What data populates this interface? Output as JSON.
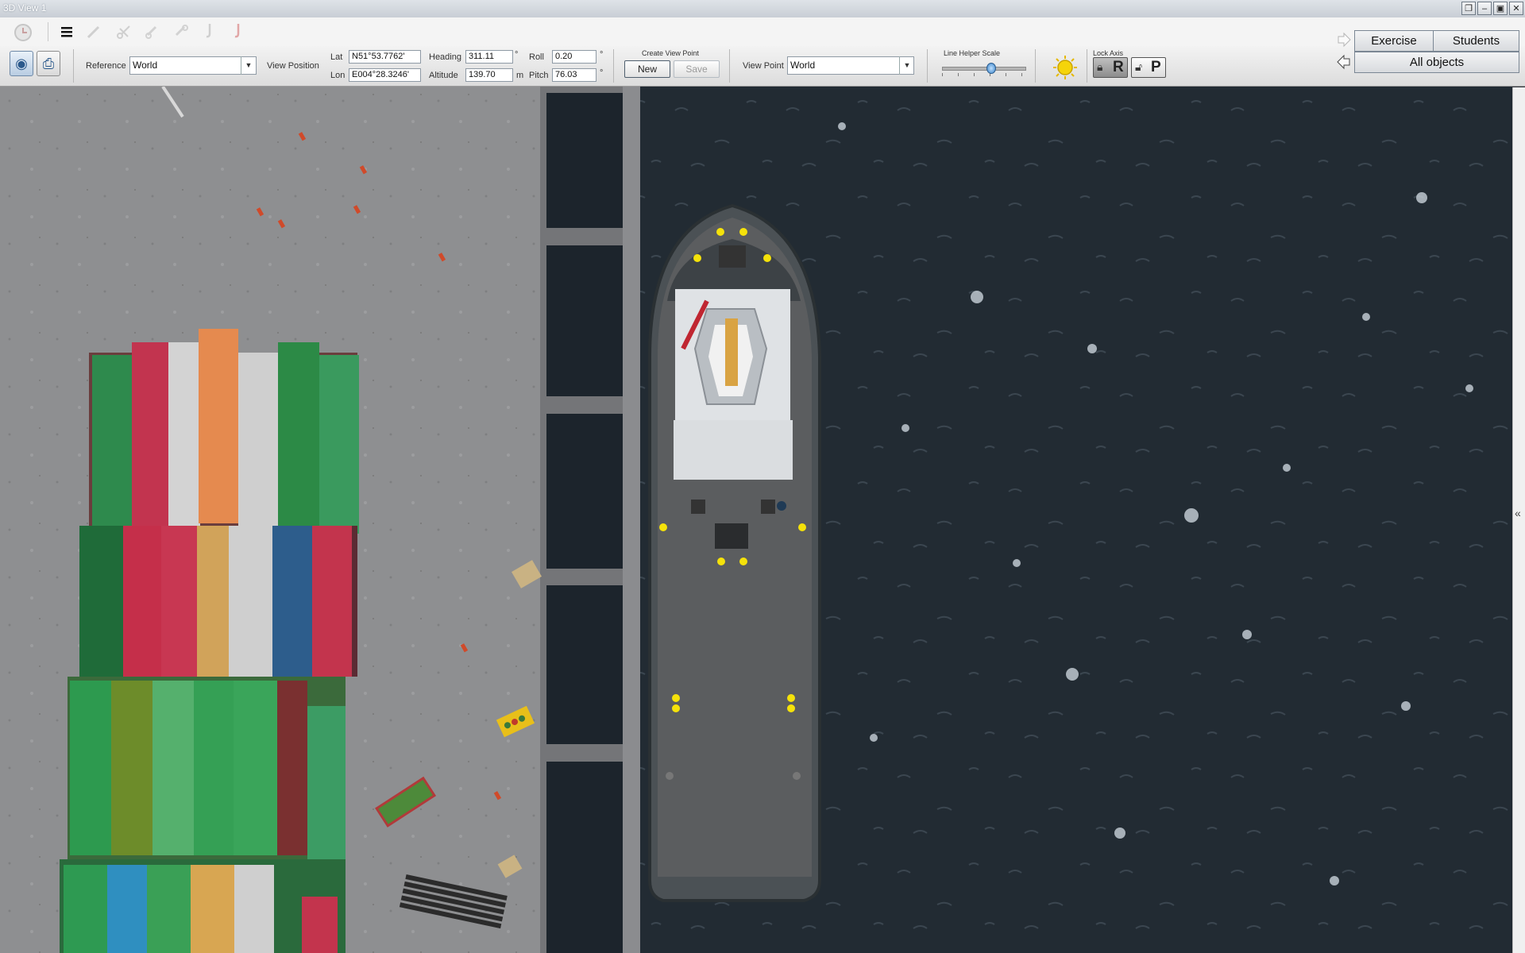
{
  "window": {
    "title": "3D View 1",
    "controls": [
      "restore-float",
      "minimize",
      "maximize",
      "close"
    ]
  },
  "icon_strip": {
    "icons": [
      "clock-icon",
      "menu-icon",
      "pencil-icon",
      "scissors-icon",
      "link-icon",
      "unlink-icon",
      "hook-icon",
      "hook-red-icon"
    ]
  },
  "toolbar": {
    "reference_label": "Reference",
    "reference_value": "World",
    "view_position_label": "View Position",
    "lat_label": "Lat",
    "lat_value": "N51°53.7762'",
    "lon_label": "Lon",
    "lon_value": "E004°28.3246'",
    "heading_label": "Heading",
    "heading_value": "311.11",
    "heading_unit": "°",
    "altitude_label": "Altitude",
    "altitude_value": "139.70",
    "altitude_unit": "m",
    "roll_label": "Roll",
    "roll_value": "0.20",
    "roll_unit": "°",
    "pitch_label": "Pitch",
    "pitch_value": "76.03",
    "pitch_unit": "°",
    "create_view_point_label": "Create View Point",
    "new_label": "New",
    "save_label": "Save",
    "view_point_label": "View Point",
    "view_point_value": "World",
    "line_helper_scale_label": "Line Helper Scale",
    "line_helper_scale_value": 0.6,
    "lock_axis_label": "Lock Axis",
    "lock_r_label": "R",
    "lock_p_label": "P"
  },
  "right_panel": {
    "exercise_label": "Exercise",
    "students_label": "Students",
    "all_objects_label": "All objects"
  },
  "collapse_glyph": "«",
  "colors": {
    "sea": "#1f2830",
    "quay": "#8f9092",
    "pier": "#6e6f72",
    "tug_hull": "#4a4f52",
    "tug_deck": "#5a5c5e",
    "accent_yellow": "#f5e20a"
  }
}
